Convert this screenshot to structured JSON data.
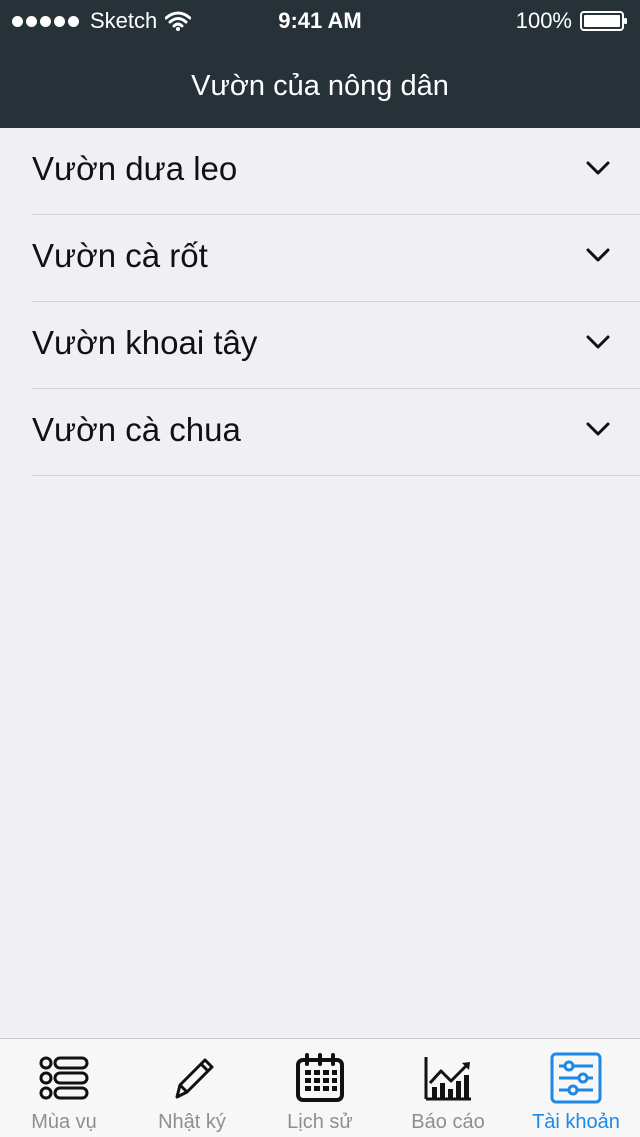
{
  "status_bar": {
    "carrier": "Sketch",
    "time": "9:41 AM",
    "battery": "100%"
  },
  "nav": {
    "title": "Vườn của nông dân"
  },
  "gardens": [
    {
      "label": "Vườn dưa leo"
    },
    {
      "label": "Vườn cà rốt"
    },
    {
      "label": "Vườn khoai tây"
    },
    {
      "label": "Vườn cà chua"
    }
  ],
  "tabs": [
    {
      "label": "Mùa vụ",
      "icon": "list-icon"
    },
    {
      "label": "Nhật ký",
      "icon": "pencil-icon"
    },
    {
      "label": "Lịch sử",
      "icon": "calendar-icon"
    },
    {
      "label": "Báo cáo",
      "icon": "chart-icon"
    },
    {
      "label": "Tài khoản",
      "icon": "settings-sliders-icon",
      "active": true
    }
  ],
  "colors": {
    "header_bg": "#263238",
    "page_bg": "#efeff4",
    "active_tab": "#1e88e5",
    "inactive_tab": "#8e8e93"
  }
}
